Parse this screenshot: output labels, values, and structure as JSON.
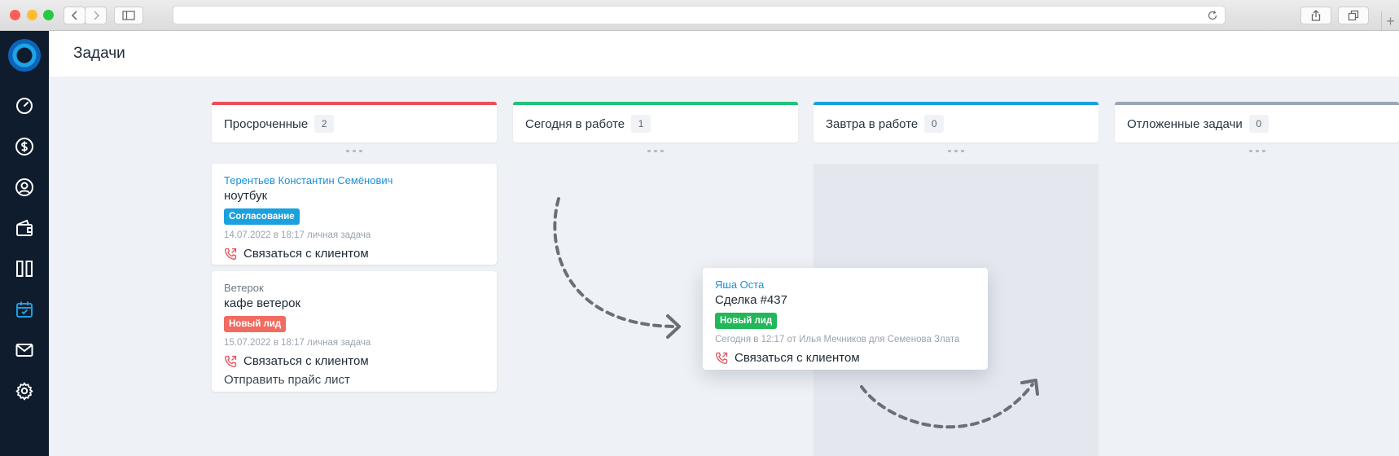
{
  "colors": {
    "sidebar_bg": "#0f1c2e",
    "overdue": "#e8505b",
    "today": "#22c17a",
    "tomorrow": "#1aa1de",
    "postponed": "#9aa6b5",
    "tag_blue": "#1aa1de",
    "tag_red": "#f06b60",
    "tag_green": "#22b85a",
    "link": "#1a8fd6"
  },
  "sidebar": {
    "logo": "app-logo",
    "items": [
      {
        "icon": "dashboard-icon"
      },
      {
        "icon": "dollar-icon"
      },
      {
        "icon": "user-icon"
      },
      {
        "icon": "wallet-icon"
      },
      {
        "icon": "columns-icon"
      },
      {
        "icon": "calendar-check-icon",
        "active": true
      },
      {
        "icon": "mail-icon"
      },
      {
        "icon": "gear-icon"
      }
    ]
  },
  "header": {
    "title": "Задачи"
  },
  "columns": [
    {
      "title": "Просроченные",
      "count": "2",
      "color": "#e8505b"
    },
    {
      "title": "Сегодня в работе",
      "count": "1",
      "color": "#22c17a"
    },
    {
      "title": "Завтра в работе",
      "count": "0",
      "color": "#1aa1de"
    },
    {
      "title": "Отложенные задачи",
      "count": "0",
      "color": "#9aa6b5"
    }
  ],
  "cards": [
    {
      "owner": "Терентьев Константин Семёнович",
      "name": "ноутбук",
      "tag": "Согласование",
      "meta": "14.07.2022 в 18:17 личная задача",
      "action": "Связаться с клиентом"
    },
    {
      "owner": "Ветерок",
      "name": "кафе ветерок",
      "tag": "Новый лид",
      "meta": "15.07.2022 в 18:17 личная задача",
      "action": "Связаться с клиентом",
      "extra": "Отправить прайс лист"
    },
    {
      "owner": "Яша Оста",
      "name": "Сделка #437",
      "tag": "Новый лид",
      "meta": "Сегодня в 12:17 от Илья Мечников для Семенова Злата",
      "action": "Связаться с клиентом"
    }
  ]
}
